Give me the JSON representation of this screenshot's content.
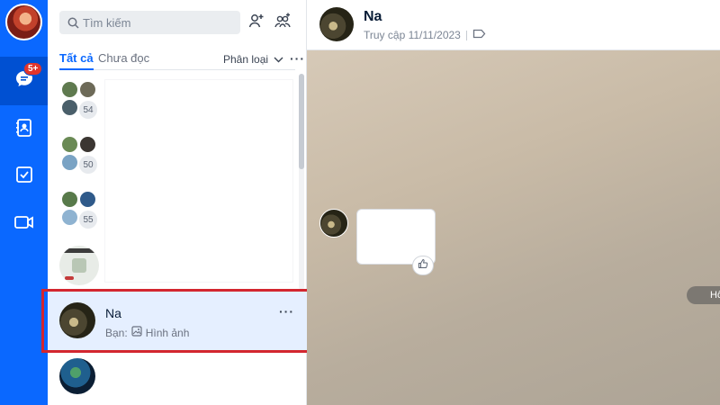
{
  "nav": {
    "badge": "5+",
    "items": [
      "messages",
      "contacts",
      "todo",
      "video-call"
    ]
  },
  "search": {
    "placeholder": "Tìm kiếm"
  },
  "tabs": {
    "all": "Tất cả",
    "unread": "Chưa đọc",
    "filter": "Phân loại",
    "more": "···"
  },
  "groups": [
    {
      "count": "54"
    },
    {
      "count": "50"
    },
    {
      "count": "55"
    }
  ],
  "selected_conversation": {
    "name": "Na",
    "preview_prefix": "Bạn:",
    "preview_text": "Hình ảnh",
    "more": "···"
  },
  "chat": {
    "title": "Na",
    "status": "Truy cập 11/11/2023",
    "side_pill": "Hô"
  },
  "colors": {
    "nav_bg": "#0a68ff",
    "nav_active": "#0050d2",
    "badge": "#e2352b",
    "accent": "#0a68ff",
    "selected_row": "#e5efff",
    "highlight_border": "#d3262f"
  }
}
